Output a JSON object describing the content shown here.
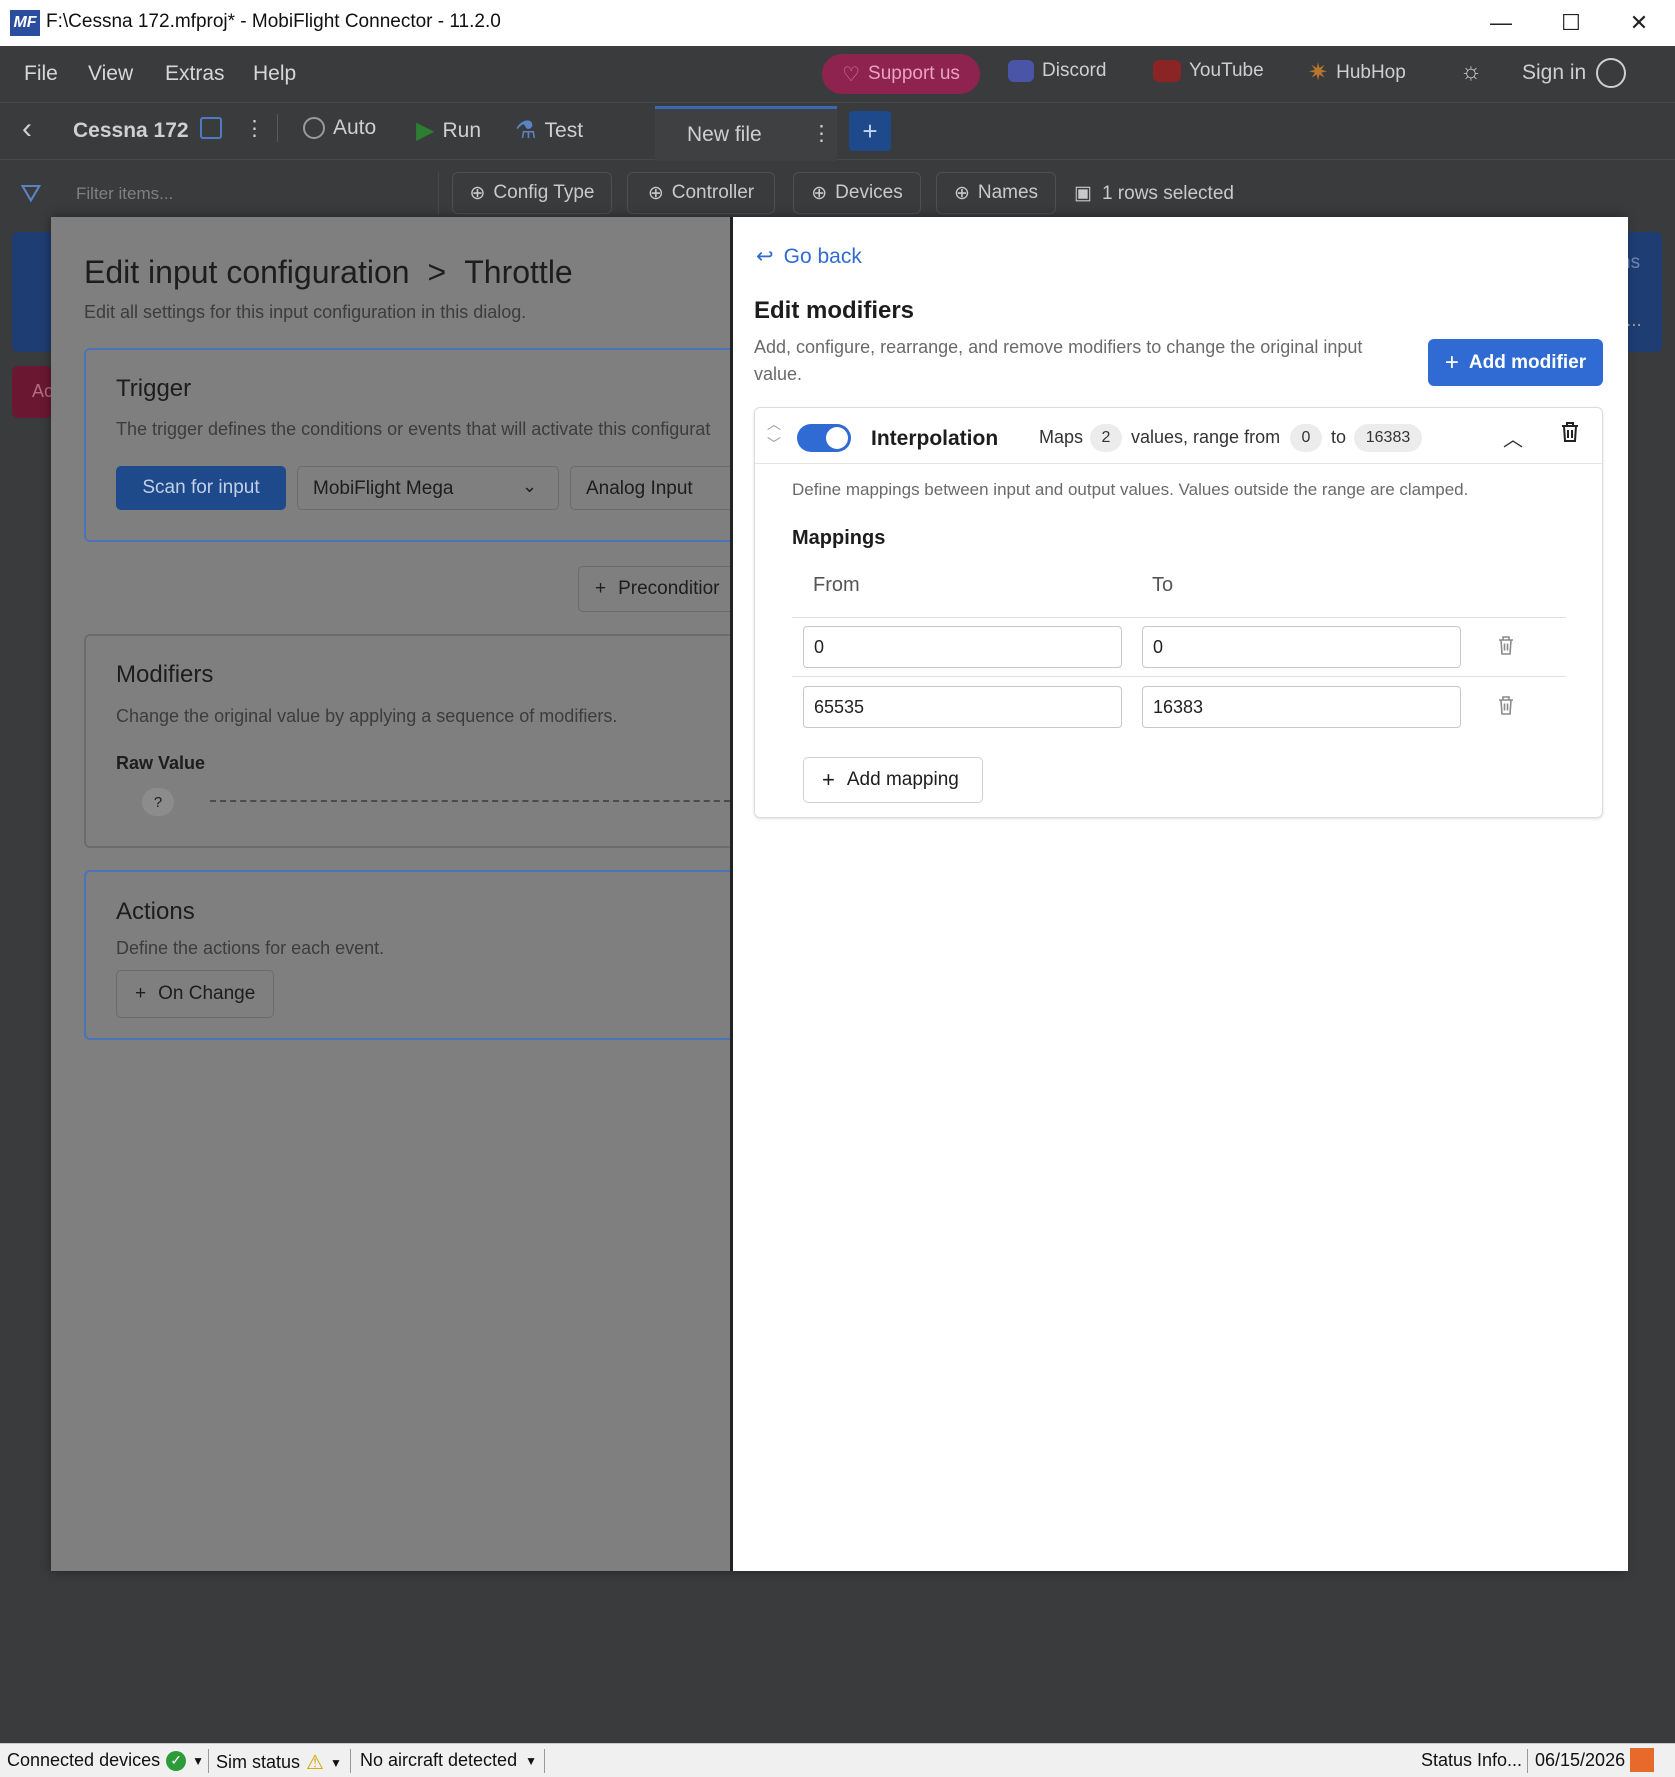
{
  "window": {
    "logo": "MF",
    "title": "F:\\Cessna 172.mfproj* - MobiFlight Connector - 11.2.0",
    "minimize_icon": "—",
    "maximize_icon": "☐",
    "close_icon": "✕"
  },
  "menu": {
    "items": [
      "File",
      "View",
      "Extras",
      "Help"
    ],
    "support": "Support us",
    "discord": "Discord",
    "youtube": "YouTube",
    "hubhop": "HubHop",
    "sign_in": "Sign in"
  },
  "toolbar": {
    "back_icon": "‹",
    "project": "Cessna 172",
    "auto": "Auto",
    "run": "Run",
    "test": "Test",
    "tab": "New file",
    "add_tab": "+"
  },
  "filterbar": {
    "placeholder": "Filter items...",
    "config_type": "Config Type",
    "controller": "Controller",
    "devices": "Devices",
    "names": "Names",
    "rows_selected": "1 rows selected"
  },
  "background_fragments": {
    "right_edge_text": "ns",
    "right_edge_more": "...",
    "left_red_text": "Ac"
  },
  "dialog": {
    "title": "Edit input configuration",
    "breadcrumb_sep": ">",
    "subtitle_name": "Throttle",
    "description": "Edit all settings for this input configuration in this dialog.",
    "trigger": {
      "title": "Trigger",
      "description": "The trigger defines the conditions or events that will activate this configurat",
      "scan_button": "Scan for input",
      "device_select": "MobiFlight Mega",
      "input_select": "Analog Input"
    },
    "precondition_button": "Preconditior",
    "modifiers": {
      "title": "Modifiers",
      "description": "Change the original value by applying a sequence of modifiers.",
      "raw_value_label": "Raw Value",
      "raw_value": "?"
    },
    "actions": {
      "title": "Actions",
      "description": "Define the actions for each event.",
      "on_change_button": "On Change"
    }
  },
  "panel": {
    "go_back": "Go back",
    "title": "Edit modifiers",
    "description": "Add, configure, rearrange, and remove modifiers to change the original input value.",
    "add_modifier": "Add modifier",
    "modifier": {
      "enabled": true,
      "name": "Interpolation",
      "maps_label": "Maps",
      "count": "2",
      "values_label": "values, range from",
      "range_from": "0",
      "to_label": "to",
      "range_to": "16383",
      "description": "Define mappings between input and output values. Values outside the range are clamped.",
      "mappings_title": "Mappings",
      "col_from": "From",
      "col_to": "To",
      "rows": [
        {
          "from": "0",
          "to": "0"
        },
        {
          "from": "65535",
          "to": "16383"
        }
      ],
      "add_mapping": "Add mapping"
    }
  },
  "statusbar": {
    "connected_devices": "Connected devices",
    "sim_status": "Sim status",
    "aircraft": "No aircraft detected",
    "status_info": "Status Info...",
    "date": "06/15/2026"
  },
  "colors": {
    "accent": "#2f6bd3",
    "support_pink": "#c2185b",
    "run_green": "#2e9b3a",
    "youtube_red": "#e53935"
  }
}
